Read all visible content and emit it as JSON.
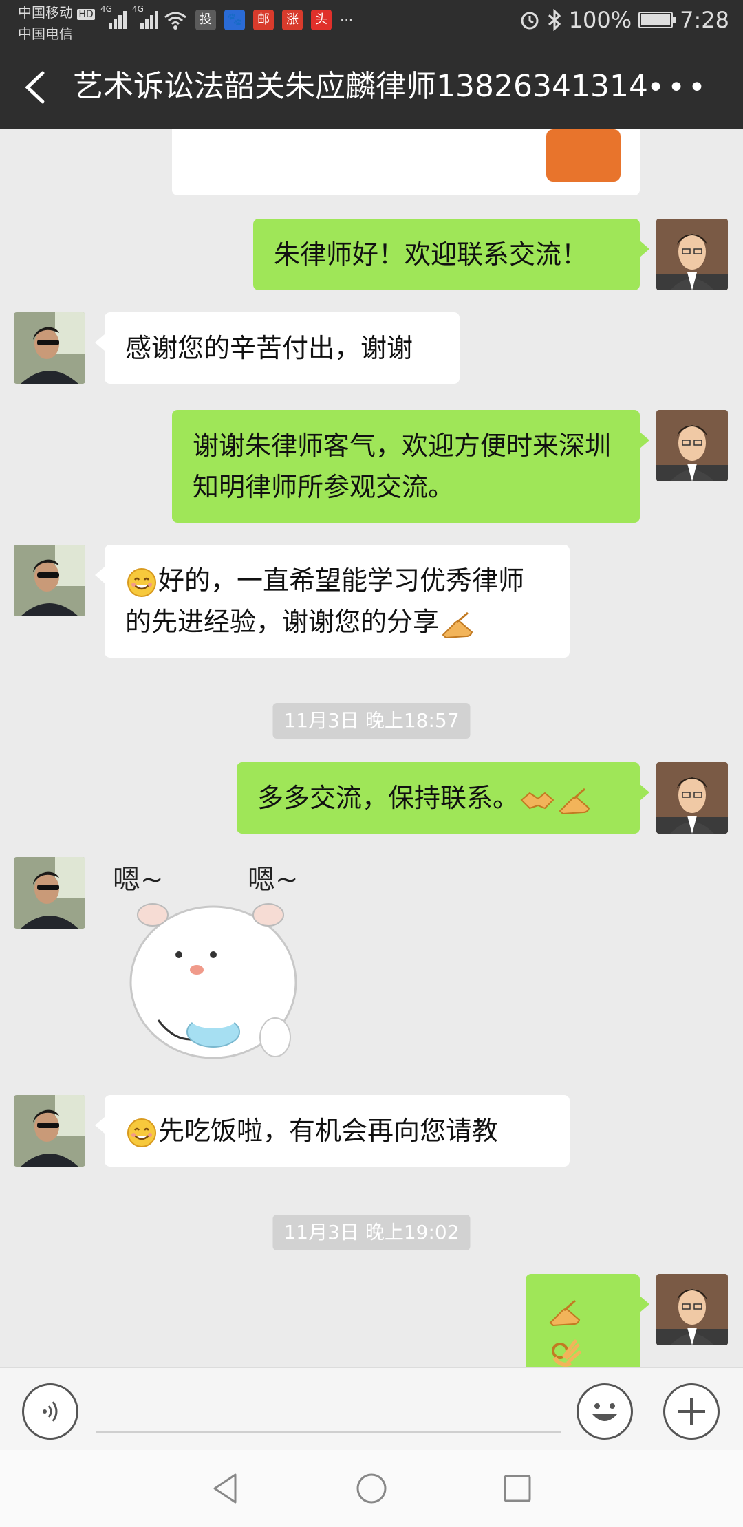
{
  "status_bar": {
    "carrier1": "中国移动",
    "hd": "HD",
    "carrier2": "中国电信",
    "net1": "4G",
    "net2": "4G",
    "battery_pct": "100%",
    "time": "7:28",
    "app_badges": [
      {
        "text": "投",
        "color": "#5b5b5b"
      },
      {
        "text": "🐾",
        "color": "#2a6bd6"
      },
      {
        "text": "邮",
        "color": "#d83b2c"
      },
      {
        "text": "涨",
        "color": "#d83b2c"
      },
      {
        "text": "头",
        "color": "#e0302b"
      }
    ],
    "more_dots": "···"
  },
  "header": {
    "title": "艺术诉讼法韶关朱应麟律师13826341314",
    "more": "•••"
  },
  "messages": [
    {
      "side": "out",
      "text": "朱律师好！欢迎联系交流！"
    },
    {
      "side": "in",
      "text": "感谢您的辛苦付出，谢谢"
    },
    {
      "side": "out",
      "text": "谢谢朱律师客气，欢迎方便时来深圳知明律师所参观交流。"
    },
    {
      "side": "in",
      "text": "好的，一直希望能学习优秀律师的先进经验，谢谢您的分享"
    },
    {
      "side": "out",
      "text": "多多交流，保持联系。"
    },
    {
      "side": "in",
      "sticker": "hamster-eating-sticker",
      "sticker_text": [
        "嗯~",
        "嗯~"
      ]
    },
    {
      "side": "in",
      "text": "先吃饭啦，有机会再向您请教"
    },
    {
      "side": "out",
      "text": ""
    }
  ],
  "timestamps": [
    "11月3日 晚上18:57",
    "11月3日 晚上19:02"
  ],
  "colors": {
    "topbar": "#2e2e2e",
    "out_bubble": "#9fe658",
    "in_bubble": "#ffffff",
    "chat_bg": "#ebebeb"
  }
}
